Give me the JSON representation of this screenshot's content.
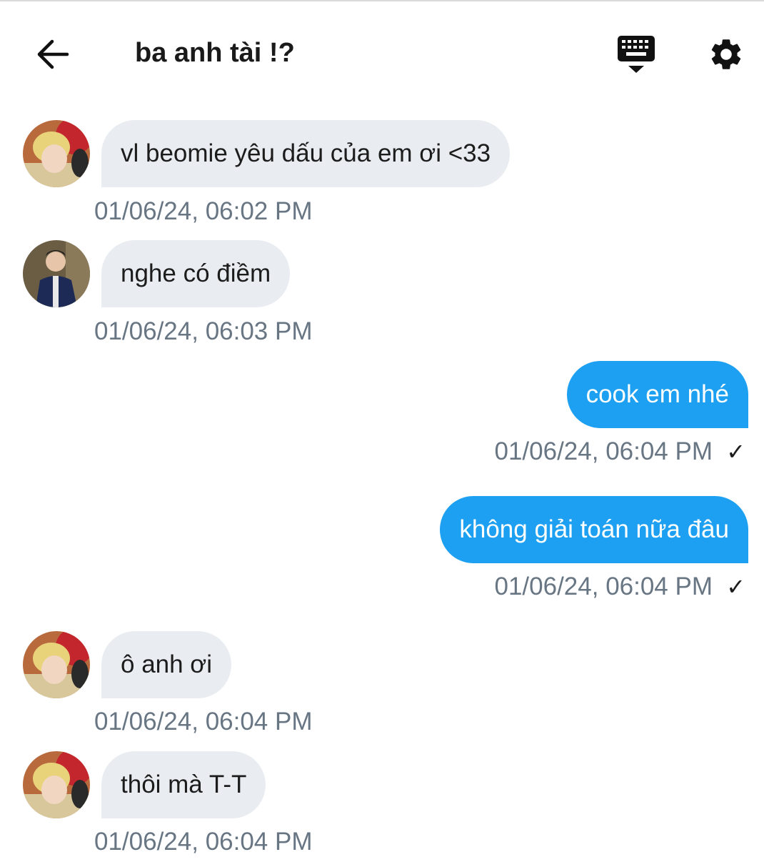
{
  "header": {
    "title": "ba anh tài !?",
    "back_icon": "arrow-left-icon",
    "keyboard_icon": "keyboard-icon",
    "settings_icon": "gear-icon"
  },
  "colors": {
    "incoming_bubble": "#e9edf1",
    "outgoing_bubble": "#1da0f2",
    "timestamp": "#687684"
  },
  "messages": [
    {
      "direction": "incoming",
      "text": "vl beomie yêu dấu của em ơi <33",
      "time": "01/06/24, 06:02 PM"
    },
    {
      "direction": "incoming",
      "text": "nghe có điềm",
      "time": "01/06/24, 06:03 PM"
    },
    {
      "direction": "outgoing",
      "text": "cook em nhé",
      "time": "01/06/24, 06:04 PM",
      "status": "✓"
    },
    {
      "direction": "outgoing",
      "text": "không giải toán nữa đâu",
      "time": "01/06/24, 06:04 PM",
      "status": "✓"
    },
    {
      "direction": "incoming",
      "text": "ô anh ơi",
      "time": "01/06/24, 06:04 PM"
    },
    {
      "direction": "incoming",
      "text": "thôi mà T-T",
      "time": "01/06/24, 06:04 PM"
    }
  ]
}
